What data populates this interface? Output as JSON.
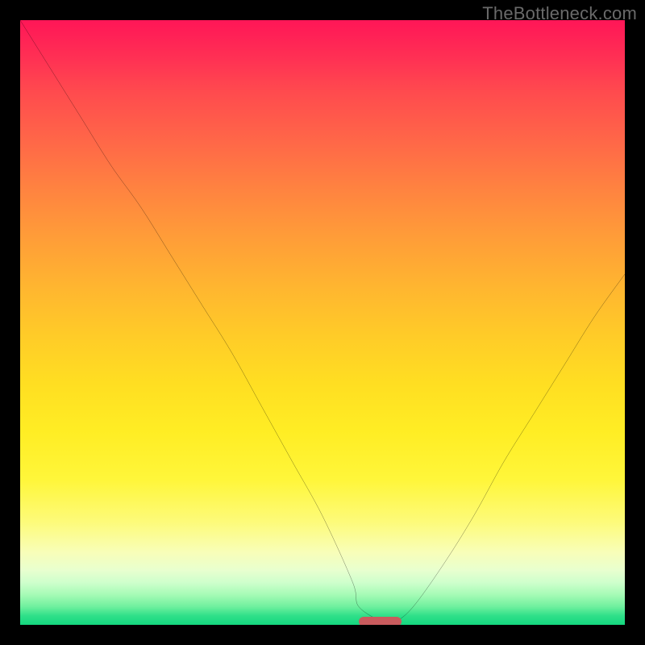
{
  "watermark": "TheBottleneck.com",
  "colors": {
    "frame_bg": "#000000",
    "curve_stroke": "#000000",
    "marker_fill": "#c95b5d",
    "watermark_text": "#6a6a6a"
  },
  "chart_data": {
    "type": "line",
    "title": "",
    "xlabel": "",
    "ylabel": "",
    "xlim": [
      0,
      100
    ],
    "ylim": [
      0,
      100
    ],
    "grid": false,
    "legend": false,
    "x": [
      0,
      5,
      10,
      15,
      20,
      25,
      30,
      35,
      40,
      45,
      50,
      55,
      56,
      60,
      62,
      65,
      70,
      75,
      80,
      85,
      90,
      95,
      100
    ],
    "values": [
      100,
      92,
      84,
      76,
      69,
      61,
      53,
      45,
      36,
      27,
      18,
      7,
      3,
      0.5,
      0.5,
      3,
      10,
      18,
      27,
      35,
      43,
      51,
      58
    ],
    "marker": {
      "x_start": 56,
      "x_end": 63,
      "y": 0.6
    },
    "background_gradient": {
      "orientation": "vertical",
      "stops": [
        {
          "pos": 0.0,
          "color": "#ff1657"
        },
        {
          "pos": 0.2,
          "color": "#ff6748"
        },
        {
          "pos": 0.44,
          "color": "#ffb530"
        },
        {
          "pos": 0.68,
          "color": "#ffed24"
        },
        {
          "pos": 0.88,
          "color": "#f8feb8"
        },
        {
          "pos": 0.95,
          "color": "#a6fbb6"
        },
        {
          "pos": 1.0,
          "color": "#14d77f"
        }
      ]
    }
  }
}
